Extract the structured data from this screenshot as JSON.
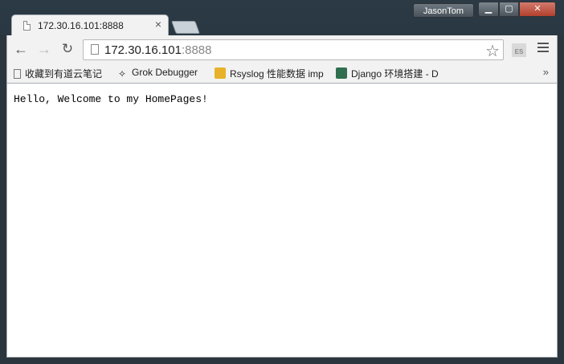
{
  "tab": {
    "title": "172.30.16.101:8888",
    "close_glyph": "×"
  },
  "window": {
    "user_name": "JasonTom",
    "minimize_glyph": "▁",
    "maximize_glyph": "▢",
    "close_glyph": "✕"
  },
  "toolbar": {
    "back_glyph": "←",
    "forward_glyph": "→",
    "reload_glyph": "↻",
    "url_host": "172.30.16.101",
    "url_port": ":8888",
    "star_glyph": "☆",
    "extension_label": "ES"
  },
  "bookmarks": {
    "items": [
      {
        "label": "收藏到有道云笔记",
        "icon": "page-icon"
      },
      {
        "label": "Grok Debugger",
        "icon": "grok-icon"
      },
      {
        "label": "Rsyslog 性能数据 imp",
        "icon": "lock-icon"
      },
      {
        "label": "Django 环境搭建 - D",
        "icon": "django-icon"
      }
    ],
    "more_glyph": "»"
  },
  "content": {
    "text": "Hello, Welcome to my HomePages!"
  }
}
